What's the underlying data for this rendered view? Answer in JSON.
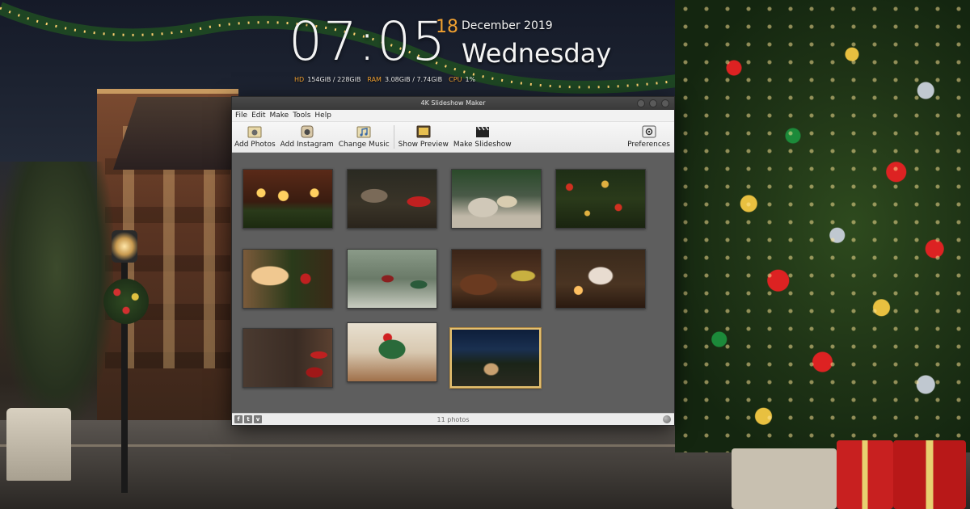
{
  "desktop": {
    "clock": {
      "time": "07:05",
      "day": "18",
      "month_year": "December 2019",
      "weekday": "Wednesday"
    },
    "sysinfo": {
      "hd_label": "HD",
      "hd_value": "154GiB / 228GiB",
      "ram_label": "RAM",
      "ram_value": "3.08GiB / 7.74GiB",
      "cpu_label": "CPU",
      "cpu_value": "1%"
    }
  },
  "window": {
    "title": "4K Slideshow Maker",
    "menu": [
      "File",
      "Edit",
      "Make",
      "Tools",
      "Help"
    ],
    "toolbar": {
      "add_photos": "Add Photos",
      "add_instagram": "Add Instagram",
      "change_music": "Change Music",
      "show_preview": "Show Preview",
      "make_slideshow": "Make Slideshow",
      "preferences": "Preferences"
    },
    "photos": [
      {
        "icon": "candles-photo",
        "selected": false
      },
      {
        "icon": "santa-hat-cat-photo",
        "selected": false
      },
      {
        "icon": "gift-boxes-photo",
        "selected": false
      },
      {
        "icon": "tree-ornaments-photo",
        "selected": false
      },
      {
        "icon": "window-decorations-photo",
        "selected": false
      },
      {
        "icon": "nutcracker-lantern-photo",
        "selected": false
      },
      {
        "icon": "christmas-room-photo",
        "selected": false
      },
      {
        "icon": "card-and-candles-photo",
        "selected": false
      },
      {
        "icon": "wrapped-gifts-photo",
        "selected": false
      },
      {
        "icon": "wreath-photo",
        "selected": false
      },
      {
        "icon": "snowy-night-cabin-photo",
        "selected": true
      }
    ],
    "status": {
      "photo_count": "11 photos",
      "social": [
        "f",
        "t",
        "v"
      ]
    }
  },
  "colors": {
    "clock_accent": "#f0a030",
    "window_bg": "#5e5e5e",
    "selection_border": "#e4c070",
    "titlebar": "#3a3a3a"
  }
}
